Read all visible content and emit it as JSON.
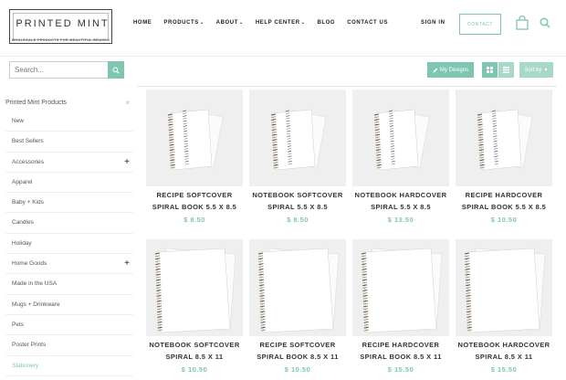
{
  "brand": {
    "logo_text_1": "PRINTED",
    "logo_text_2": "MINT",
    "tagline": "WHOLESALE PRODUCTS for BEAUTIFUL BRANDS"
  },
  "nav": [
    {
      "label": "HOME",
      "has_dropdown": false
    },
    {
      "label": "PRODUCTS",
      "has_dropdown": true
    },
    {
      "label": "ABOUT",
      "has_dropdown": true
    },
    {
      "label": "HELP CENTER",
      "has_dropdown": true
    },
    {
      "label": "BLOG",
      "has_dropdown": false
    },
    {
      "label": "CONTACT US",
      "has_dropdown": false
    }
  ],
  "header": {
    "signin_label": "SIGN IN",
    "contact_label": "CONTACT"
  },
  "toolbar": {
    "search_placeholder": "Search...",
    "my_designs_label": "My Designs",
    "sort_label": "Sort by"
  },
  "sidebar": {
    "heading": "Printed Mint Products",
    "close_symbol": "×",
    "items": [
      {
        "label": "New",
        "expandable": false,
        "active": false
      },
      {
        "label": "Best Sellers",
        "expandable": false,
        "active": false
      },
      {
        "label": "Accessories",
        "expandable": true,
        "active": false
      },
      {
        "label": "Apparel",
        "expandable": false,
        "active": false
      },
      {
        "label": "Baby + Kids",
        "expandable": false,
        "active": false
      },
      {
        "label": "Candles",
        "expandable": false,
        "active": false
      },
      {
        "label": "Holiday",
        "expandable": false,
        "active": false
      },
      {
        "label": "Home Goods",
        "expandable": true,
        "active": false
      },
      {
        "label": "Made in the USA",
        "expandable": false,
        "active": false
      },
      {
        "label": "Mugs + Drinkware",
        "expandable": false,
        "active": false
      },
      {
        "label": "Pets",
        "expandable": false,
        "active": false
      },
      {
        "label": "Poster Prints",
        "expandable": false,
        "active": false
      },
      {
        "label": "Stationery",
        "expandable": false,
        "active": true
      }
    ]
  },
  "products": [
    {
      "line1": "RECIPE SOFTCOVER",
      "line2": "SPIRAL BOOK 5.5 X 8.5",
      "price": "$ 8.50",
      "size": "small"
    },
    {
      "line1": "NOTEBOOK SOFTCOVER",
      "line2": "SPIRAL 5.5 X 8.5",
      "price": "$ 8.50",
      "size": "small"
    },
    {
      "line1": "NOTEBOOK HARDCOVER",
      "line2": "SPIRAL 5.5 X 8.5",
      "price": "$ 13.50",
      "size": "small"
    },
    {
      "line1": "RECIPE HARDCOVER",
      "line2": "SPIRAL BOOK 5.5 X 8.5",
      "price": "$ 10.50",
      "size": "small"
    },
    {
      "line1": "NOTEBOOK SOFTCOVER",
      "line2": "SPIRAL 8.5 X 11",
      "price": "$ 10.50",
      "size": "large"
    },
    {
      "line1": "RECIPE SOFTCOVER",
      "line2": "SPIRAL BOOK 8.5 X 11",
      "price": "$ 10.50",
      "size": "large"
    },
    {
      "line1": "RECIPE HARDCOVER",
      "line2": "SPIRAL BOOK 8.5 X 11",
      "price": "$ 15.50",
      "size": "large"
    },
    {
      "line1": "NOTEBOOK HARDCOVER",
      "line2": "SPIRAL 8.5 X 11",
      "price": "$ 15.50",
      "size": "large"
    }
  ],
  "colors": {
    "accent": "#7fc6b2",
    "accent_light": "#a8d8ca",
    "card_bg": "#efefef"
  }
}
